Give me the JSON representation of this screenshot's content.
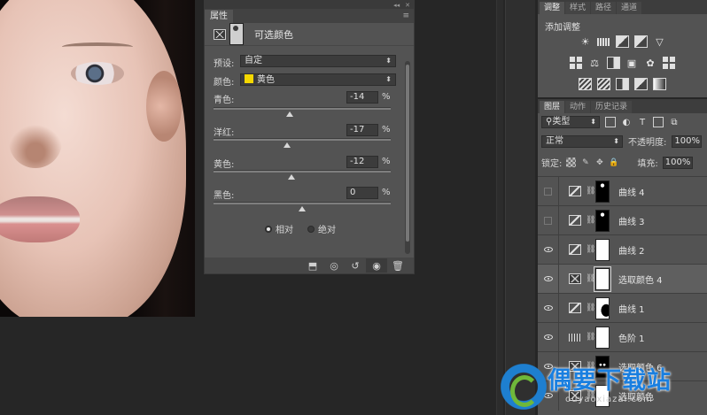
{
  "properties": {
    "tab": "属性",
    "title": "可选颜色",
    "preset_label": "预设:",
    "preset_value": "自定",
    "colors_label": "颜色:",
    "colors_value": "黄色",
    "colors_swatch": "#f5d800",
    "sliders": [
      {
        "label": "青色:",
        "value": "-14",
        "unit": "%",
        "level": -14
      },
      {
        "label": "洋红:",
        "value": "-17",
        "unit": "%",
        "level": -17
      },
      {
        "label": "黄色:",
        "value": "-12",
        "unit": "%",
        "level": -12
      },
      {
        "label": "黑色:",
        "value": "0",
        "unit": "%",
        "level": 0
      }
    ],
    "mode_relative": "相对",
    "mode_absolute": "绝对",
    "mode_selected": "相对"
  },
  "adjustments": {
    "tabs": [
      "调整",
      "样式",
      "路径",
      "通道"
    ],
    "active_tab": "调整",
    "title": "添加调整"
  },
  "layers": {
    "tabs": [
      "图层",
      "动作",
      "历史记录"
    ],
    "active_tab": "图层",
    "filter_kind": "类型",
    "blend_mode": "正常",
    "opacity_label": "不透明度:",
    "opacity_value": "100%",
    "lock_label": "锁定:",
    "fill_label": "填充:",
    "fill_value": "100%",
    "items": [
      {
        "name": "曲线 4",
        "visible": false,
        "icon": "curves",
        "mask": "blackdot"
      },
      {
        "name": "曲线 3",
        "visible": false,
        "icon": "curves",
        "mask": "blackdot"
      },
      {
        "name": "曲线 2",
        "visible": true,
        "icon": "curves",
        "mask": "white"
      },
      {
        "name": "选取颜色 4",
        "visible": true,
        "icon": "selective-color",
        "mask": "white",
        "selected": true
      },
      {
        "name": "曲线 1",
        "visible": true,
        "icon": "curves",
        "mask": "curvemask"
      },
      {
        "name": "色阶 1",
        "visible": true,
        "icon": "levels",
        "mask": "white"
      },
      {
        "name": "选取颜色 6",
        "visible": true,
        "icon": "selective-color",
        "mask": "dots"
      },
      {
        "name": "选取颜色",
        "visible": true,
        "icon": "selective-color",
        "mask": "white"
      }
    ]
  },
  "watermark": {
    "title": "偶要下载站",
    "url": "ouyaoxiazai.com"
  }
}
